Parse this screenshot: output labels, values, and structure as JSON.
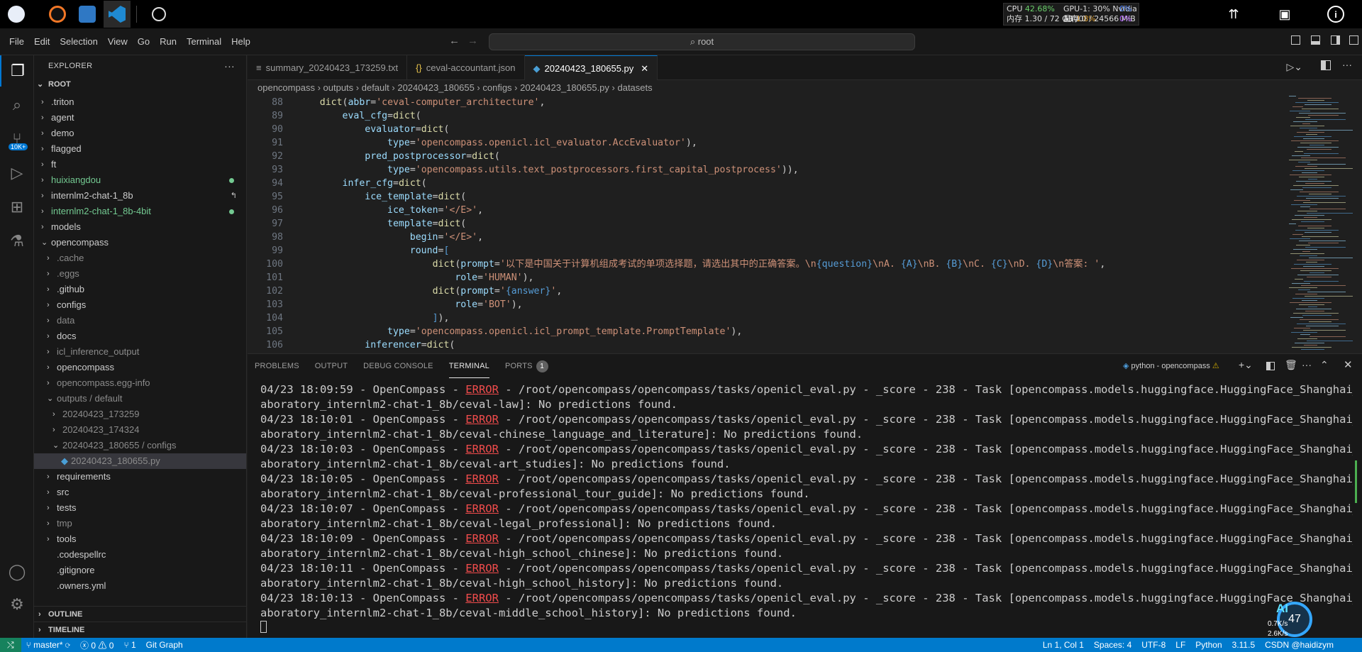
{
  "topbar": {
    "apps": [
      "jupyter-icon",
      "vscode-icon",
      "vscode-blue-icon",
      "compass-icon"
    ],
    "sysmon": {
      "cpu_label": "CPU",
      "cpu_value": "42.68%",
      "gpu_label": "GPU-1: 30% Nvidia A100",
      "gpu_value": "0%",
      "mem_label": "内存 1.30 / 72 GB",
      "mem_value": "1.8%",
      "vram_label": "显存 0 / 24566 MiB",
      "vram_value": "0%"
    }
  },
  "menu": [
    "File",
    "Edit",
    "Selection",
    "View",
    "Go",
    "Run",
    "Terminal",
    "Help"
  ],
  "command_center": {
    "text": "root"
  },
  "activity": {
    "badge": "10K+"
  },
  "explorer": {
    "title": "EXPLORER",
    "root": "ROOT",
    "items": [
      {
        "label": ".triton",
        "indent": 0,
        "color": "#cccccc",
        "chev": "›"
      },
      {
        "label": "agent",
        "indent": 0,
        "color": "#cccccc",
        "chev": "›"
      },
      {
        "label": "demo",
        "indent": 0,
        "color": "#cccccc",
        "chev": "›"
      },
      {
        "label": "flagged",
        "indent": 0,
        "color": "#cccccc",
        "chev": "›"
      },
      {
        "label": "ft",
        "indent": 0,
        "color": "#cccccc",
        "chev": "›"
      },
      {
        "label": "huixiangdou",
        "indent": 0,
        "color": "#73c991",
        "chev": "›",
        "dot": true
      },
      {
        "label": "internlm2-chat-1_8b",
        "indent": 0,
        "color": "#cccccc",
        "chev": "›",
        "link": true
      },
      {
        "label": "internlm2-chat-1_8b-4bit",
        "indent": 0,
        "color": "#73c991",
        "chev": "›",
        "dot": true
      },
      {
        "label": "models",
        "indent": 0,
        "color": "#cccccc",
        "chev": "›"
      },
      {
        "label": "opencompass",
        "indent": 0,
        "color": "#cccccc",
        "chev": "⌄"
      },
      {
        "label": ".cache",
        "indent": 1,
        "color": "#8b8b8b",
        "chev": "›"
      },
      {
        "label": ".eggs",
        "indent": 1,
        "color": "#8b8b8b",
        "chev": "›"
      },
      {
        "label": ".github",
        "indent": 1,
        "color": "#cccccc",
        "chev": "›"
      },
      {
        "label": "configs",
        "indent": 1,
        "color": "#cccccc",
        "chev": "›"
      },
      {
        "label": "data",
        "indent": 1,
        "color": "#8b8b8b",
        "chev": "›"
      },
      {
        "label": "docs",
        "indent": 1,
        "color": "#cccccc",
        "chev": "›"
      },
      {
        "label": "icl_inference_output",
        "indent": 1,
        "color": "#8b8b8b",
        "chev": "›"
      },
      {
        "label": "opencompass",
        "indent": 1,
        "color": "#cccccc",
        "chev": "›"
      },
      {
        "label": "opencompass.egg-info",
        "indent": 1,
        "color": "#8b8b8b",
        "chev": "›"
      },
      {
        "label": "outputs / default",
        "indent": 1,
        "color": "#8b8b8b",
        "chev": "⌄"
      },
      {
        "label": "20240423_173259",
        "indent": 2,
        "color": "#8b8b8b",
        "chev": "›"
      },
      {
        "label": "20240423_174324",
        "indent": 2,
        "color": "#8b8b8b",
        "chev": "›"
      },
      {
        "label": "20240423_180655 / configs",
        "indent": 2,
        "color": "#8b8b8b",
        "chev": "⌄"
      },
      {
        "label": "20240423_180655.py",
        "indent": 3,
        "color": "#8b8b8b",
        "chev": "",
        "selected": true
      },
      {
        "label": "requirements",
        "indent": 1,
        "color": "#cccccc",
        "chev": "›"
      },
      {
        "label": "src",
        "indent": 1,
        "color": "#cccccc",
        "chev": "›"
      },
      {
        "label": "tests",
        "indent": 1,
        "color": "#cccccc",
        "chev": "›"
      },
      {
        "label": "tmp",
        "indent": 1,
        "color": "#8b8b8b",
        "chev": "›"
      },
      {
        "label": "tools",
        "indent": 1,
        "color": "#cccccc",
        "chev": "›"
      },
      {
        "label": ".codespellrc",
        "indent": 1,
        "color": "#cccccc",
        "chev": ""
      },
      {
        "label": ".gitignore",
        "indent": 1,
        "color": "#cccccc",
        "chev": ""
      },
      {
        "label": ".owners.yml",
        "indent": 1,
        "color": "#cccccc",
        "chev": ""
      }
    ],
    "outline": "OUTLINE",
    "timeline": "TIMELINE"
  },
  "tabs": [
    {
      "label": "summary_20240423_173259.txt",
      "icon": "≡",
      "icon_color": "#9d9d9d",
      "active": false
    },
    {
      "label": "ceval-accountant.json",
      "icon": "{}",
      "icon_color": "#e8c34b",
      "active": false
    },
    {
      "label": "20240423_180655.py",
      "icon": "◆",
      "icon_color": "#4a9fd6",
      "active": true
    }
  ],
  "breadcrumb": [
    "opencompass",
    "outputs",
    "default",
    "20240423_180655",
    "configs",
    "20240423_180655.py",
    "datasets"
  ],
  "code": [
    {
      "n": "88",
      "html": "    <span class='k'>dict</span>(<span class='v'>abbr</span>=<span class='s'>'ceval-computer_architecture'</span>,"
    },
    {
      "n": "89",
      "html": "        <span class='v'>eval_cfg</span>=<span class='k'>dict</span>("
    },
    {
      "n": "90",
      "html": "            <span class='v'>evaluator</span>=<span class='k'>dict</span>("
    },
    {
      "n": "91",
      "html": "                <span class='v'>type</span>=<span class='s'>'opencompass.openicl.icl_evaluator.AccEvaluator'</span>),"
    },
    {
      "n": "92",
      "html": "            <span class='v'>pred_postprocessor</span>=<span class='k'>dict</span>("
    },
    {
      "n": "93",
      "html": "                <span class='v'>type</span>=<span class='s'>'opencompass.utils.text_postprocessors.first_capital_postprocess'</span>)),"
    },
    {
      "n": "94",
      "html": "        <span class='v'>infer_cfg</span>=<span class='k'>dict</span>("
    },
    {
      "n": "95",
      "html": "            <span class='v'>ice_template</span>=<span class='k'>dict</span>("
    },
    {
      "n": "96",
      "html": "                <span class='v'>ice_token</span>=<span class='s'>'&lt;/E&gt;'</span>,"
    },
    {
      "n": "97",
      "html": "                <span class='v'>template</span>=<span class='k'>dict</span>("
    },
    {
      "n": "98",
      "html": "                    <span class='v'>begin</span>=<span class='s'>'&lt;/E&gt;'</span>,"
    },
    {
      "n": "99",
      "html": "                    <span class='v'>round</span>=<span class='b'>[</span>"
    },
    {
      "n": "100",
      "html": "                        <span class='k'>dict</span>(<span class='v'>prompt</span>=<span class='s'>'以下是中国关于计算机组成考试的单项选择题，请选出其中的正确答案。\\n</span><span class='b'>{question}</span><span class='s'>\\nA. </span><span class='b'>{A}</span><span class='s'>\\nB. </span><span class='b'>{B}</span><span class='s'>\\nC. </span><span class='b'>{C}</span><span class='s'>\\nD. </span><span class='b'>{D}</span><span class='s'>\\n答案: '</span>,"
    },
    {
      "n": "101",
      "html": "                            <span class='v'>role</span>=<span class='s'>'HUMAN'</span>),"
    },
    {
      "n": "102",
      "html": "                        <span class='k'>dict</span>(<span class='v'>prompt</span>=<span class='s'>'</span><span class='b'>{answer}</span><span class='s'>'</span>,"
    },
    {
      "n": "103",
      "html": "                            <span class='v'>role</span>=<span class='s'>'BOT'</span>),"
    },
    {
      "n": "104",
      "html": "                        <span class='b'>]</span>),"
    },
    {
      "n": "105",
      "html": "                <span class='v'>type</span>=<span class='s'>'opencompass.openicl.icl_prompt_template.PromptTemplate'</span>),"
    },
    {
      "n": "106",
      "html": "            <span class='v'>inferencer</span>=<span class='k'>dict</span>("
    }
  ],
  "panel": {
    "tabs": [
      "PROBLEMS",
      "OUTPUT",
      "DEBUG CONSOLE",
      "TERMINAL",
      "PORTS"
    ],
    "ports_badge": "1",
    "terminal_name": "python - opencompass",
    "lines": [
      {
        "time": "04/23 18:09:59",
        "task": "ceval-law"
      },
      {
        "time": "04/23 18:10:01",
        "task": "ceval-chinese_language_and_literature"
      },
      {
        "time": "04/23 18:10:03",
        "task": "ceval-art_studies"
      },
      {
        "time": "04/23 18:10:05",
        "task": "ceval-professional_tour_guide"
      },
      {
        "time": "04/23 18:10:07",
        "task": "ceval-legal_professional"
      },
      {
        "time": "04/23 18:10:09",
        "task": "ceval-high_school_chinese"
      },
      {
        "time": "04/23 18:10:11",
        "task": "ceval-high_school_history"
      },
      {
        "time": "04/23 18:10:13",
        "task": "ceval-middle_school_history"
      }
    ],
    "line_mid": " - OpenCompass - ",
    "error_word": "ERROR",
    "line_tail_1": " - /root/opencompass/opencompass/tasks/openicl_eval.py - _score - 238 - Task [opencompass.models.huggingface.HuggingFace_Shanghai_AI_L",
    "line_tail_2_prefix": "aboratory_internlm2-chat-1_8b/",
    "line_tail_2_suffix": "]: No predictions found."
  },
  "status": {
    "branch": "master*",
    "errors": "0",
    "warnings": "0",
    "ports": "1",
    "gitgraph": "Git Graph",
    "position": "Ln 1, Col 1",
    "spaces": "Spaces: 4",
    "encoding": "UTF-8",
    "eol": "LF",
    "language": "Python",
    "version": "3.11.5",
    "watermark": "CSDN @haidizym"
  },
  "overlay": {
    "percent": "47",
    "net_up": "0.7K/s",
    "net_down": "2.6K/s",
    "ai": "AI"
  }
}
